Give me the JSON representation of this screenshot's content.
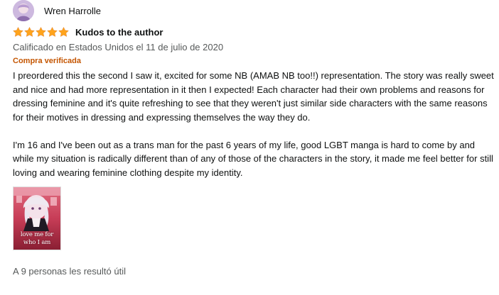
{
  "profile": {
    "name": "Wren Harrolle",
    "avatar_icon": "user-avatar"
  },
  "review": {
    "rating": 5,
    "rating_max": 5,
    "star_color": "#ffa41c",
    "title": "Kudos to the author",
    "date": "Calificado en Estados Unidos el 11 de julio de 2020",
    "verified": "Compra verificada",
    "body": [
      "I preordered this the second I saw it, excited for some NB (AMAB NB too!!) representation. The story was really sweet and nice and had more representation in it then I expected! Each character had their own problems and reasons for dressing feminine and it's quite refreshing to see that they weren't just similar side characters with the same reasons for their motives in dressing and expressing themselves the way they do.",
      "I'm 16 and I've been out as a trans man for the past 6 years of my life, good LGBT manga is hard to come by and while my situation is radically different than of any of those of the characters in the story, it made me feel better for still loving and wearing feminine clothing despite my identity."
    ],
    "image": {
      "caption_line1": "love me for",
      "caption_line2": "who I am"
    },
    "helpful": "A 9 personas les resultó útil"
  }
}
